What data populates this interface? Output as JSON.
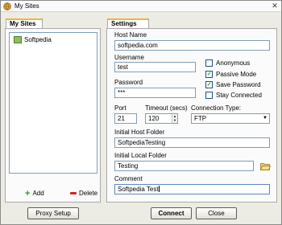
{
  "window": {
    "title": "My Sites"
  },
  "left": {
    "tab_label": "My Sites",
    "sites": [
      "Softpedia"
    ],
    "add_label": "Add",
    "delete_label": "Delete",
    "proxy_label": "Proxy Setup"
  },
  "settings": {
    "tab_label": "Settings",
    "host_name_label": "Host Name",
    "host_name_value": "softpedia.com",
    "username_label": "Username",
    "username_value": "test",
    "password_label": "Password",
    "password_value": "***",
    "port_label": "Port",
    "port_value": "21",
    "timeout_label": "Timeout (secs)",
    "timeout_value": "120",
    "connection_type_label": "Connection Type:",
    "connection_type_value": "FTP",
    "initial_host_folder_label": "Initial Host Folder",
    "initial_host_folder_value": "SoftpediaTesting",
    "initial_local_folder_label": "Initial Local Folder",
    "initial_local_folder_value": "Testing",
    "comment_label": "Comment",
    "comment_value": "Softpedia Test",
    "options": [
      {
        "label": "Anonymous",
        "checked": false
      },
      {
        "label": "Passive Mode",
        "checked": true
      },
      {
        "label": "Save Password",
        "checked": true
      },
      {
        "label": "Stay Connected",
        "checked": false
      }
    ]
  },
  "buttons": {
    "connect": "Connect",
    "close": "Close"
  },
  "icons": {
    "app": "globe-icon",
    "close": "close-icon",
    "site": "site-icon",
    "add": "plus-icon",
    "delete": "minus-icon",
    "folder": "folder-open-icon"
  },
  "colors": {
    "add_green": "#1f9d28",
    "delete_red": "#d62020",
    "tab_accent": "#f3b331",
    "check_green": "#21a121"
  }
}
